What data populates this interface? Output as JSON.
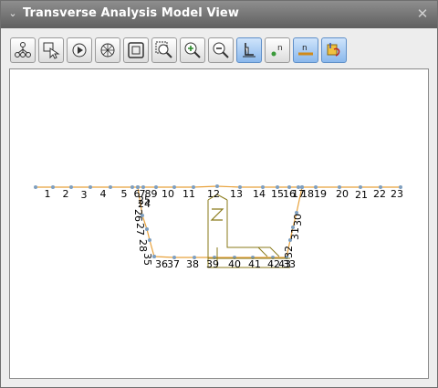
{
  "window": {
    "title": "Transverse Analysis Model View",
    "close_glyph": "✕",
    "collapse_glyph": "⌄"
  },
  "toolbar": {
    "buttons": [
      {
        "name": "node-tree-icon"
      },
      {
        "name": "select-element-icon"
      },
      {
        "name": "play-icon"
      },
      {
        "name": "rotate-icon"
      },
      {
        "name": "fit-view-icon"
      },
      {
        "name": "zoom-window-icon"
      },
      {
        "name": "zoom-in-icon"
      },
      {
        "name": "zoom-out-icon"
      },
      {
        "name": "boundary-icon",
        "active": true
      },
      {
        "name": "node-number-icon"
      },
      {
        "name": "element-number-icon",
        "active": true
      },
      {
        "name": "load-display-icon",
        "active": true
      }
    ]
  },
  "colors": {
    "member": "#e8a23c",
    "node": "#7f9fbf",
    "section": "#8a7a1a",
    "active_button": "#8ab8ec"
  },
  "model": {
    "node_labels": [
      "1",
      "2",
      "3",
      "4",
      "5",
      "6",
      "7",
      "8",
      "9",
      "10",
      "11",
      "12",
      "13",
      "14",
      "15",
      "16",
      "17",
      "18",
      "19",
      "20",
      "21",
      "22",
      "23",
      "24",
      "25",
      "26",
      "27",
      "28",
      "35",
      "36",
      "37",
      "38",
      "39",
      "40",
      "41",
      "42",
      "43",
      "33",
      "32",
      "31",
      "30"
    ]
  }
}
